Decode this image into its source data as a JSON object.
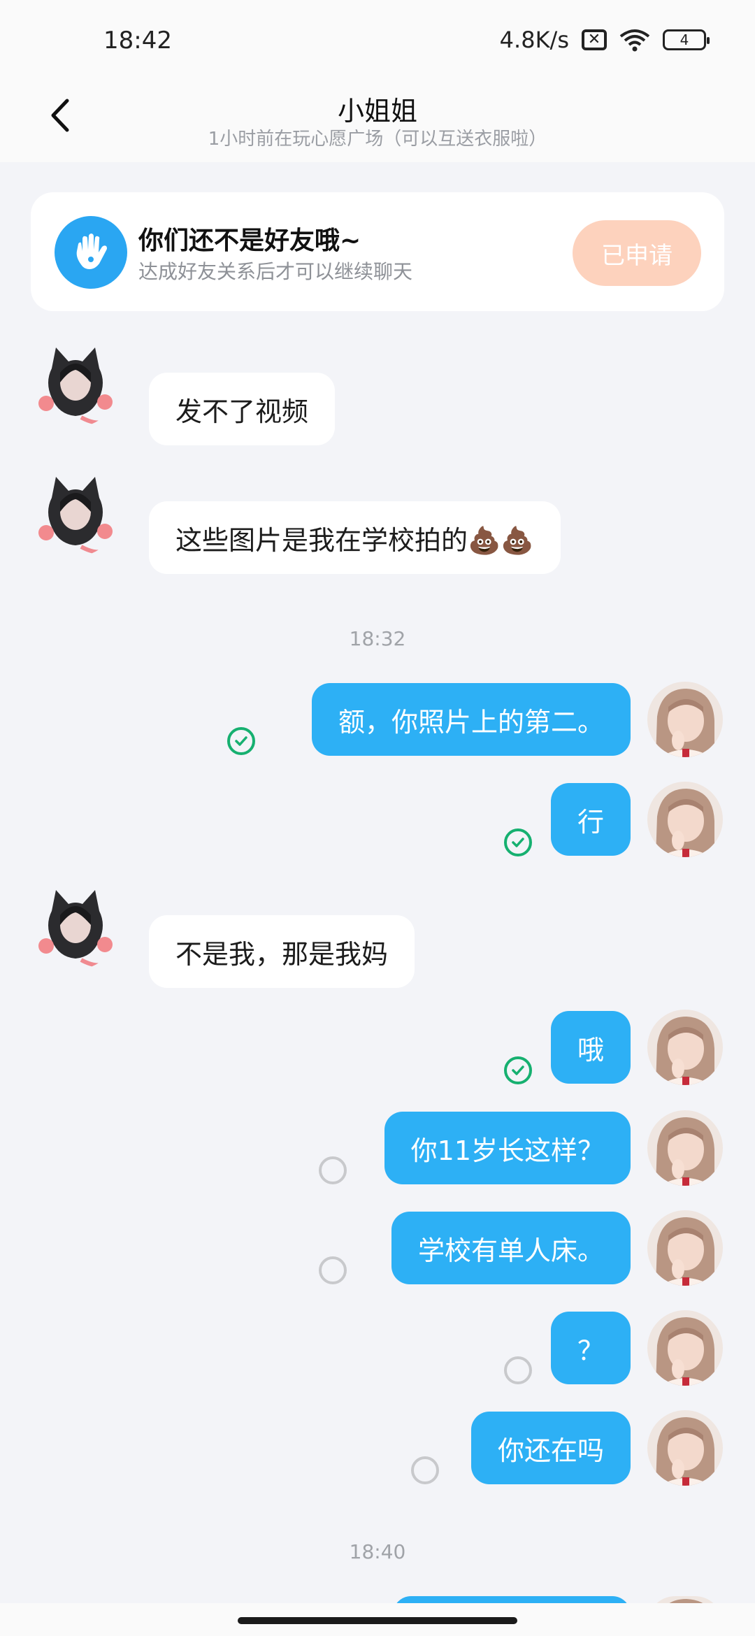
{
  "status_bar": {
    "time": "18:42",
    "network_speed": "4.8K/s",
    "sim_icon_glyph": "✕",
    "battery_level": "4"
  },
  "header": {
    "title": "小姐姐",
    "subtitle": "1小时前在玩心愿广场（可以互送衣服啦）"
  },
  "friend_banner": {
    "title": "你们还不是好友哦~",
    "subtitle": "达成好友关系后才可以继续聊天",
    "button_label": "已申请"
  },
  "messages": [
    {
      "side": "in",
      "text": "发不了视频"
    },
    {
      "side": "in",
      "text": "这些图片是我在学校拍的💩💩"
    },
    {
      "side": "time",
      "text": "18:32"
    },
    {
      "side": "out",
      "text": "额，你照片上的第二。",
      "status": "read"
    },
    {
      "side": "out",
      "text": "行",
      "status": "read"
    },
    {
      "side": "in",
      "text": "不是我，那是我妈"
    },
    {
      "side": "out",
      "text": "哦",
      "status": "read"
    },
    {
      "side": "out",
      "text": "你11岁长这样？",
      "status": "unread"
    },
    {
      "side": "out",
      "text": "学校有单人床。",
      "status": "unread"
    },
    {
      "side": "out",
      "text": "？",
      "status": "unread"
    },
    {
      "side": "out",
      "text": "你还在吗",
      "status": "unread"
    },
    {
      "side": "time",
      "text": "18:40"
    }
  ],
  "colors": {
    "accent_blue": "#2db0f5",
    "read_green": "#16b070",
    "apply_button": "#fdd2bd"
  }
}
